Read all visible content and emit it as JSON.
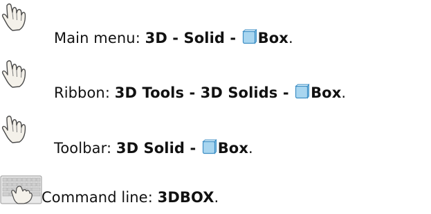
{
  "rows": [
    {
      "label": "Main menu: ",
      "path": "3D - Solid - ",
      "command": "Box",
      "end": "."
    },
    {
      "label": "Ribbon: ",
      "path": "3D Tools - 3D Solids - ",
      "command": "Box",
      "end": "."
    },
    {
      "label": "Toolbar: ",
      "path": "3D Solid - ",
      "command": "Box",
      "end": "."
    },
    {
      "label": "Command line: ",
      "command": "3DBOX",
      "end": "."
    }
  ],
  "icons": {
    "pointer": "hand-pointer-icon",
    "keyboard": "keyboard-icon",
    "box": "box-icon"
  },
  "colors": {
    "text": "#111111",
    "box_face": "#a9d6f0",
    "box_edge": "#3d8ec4"
  }
}
